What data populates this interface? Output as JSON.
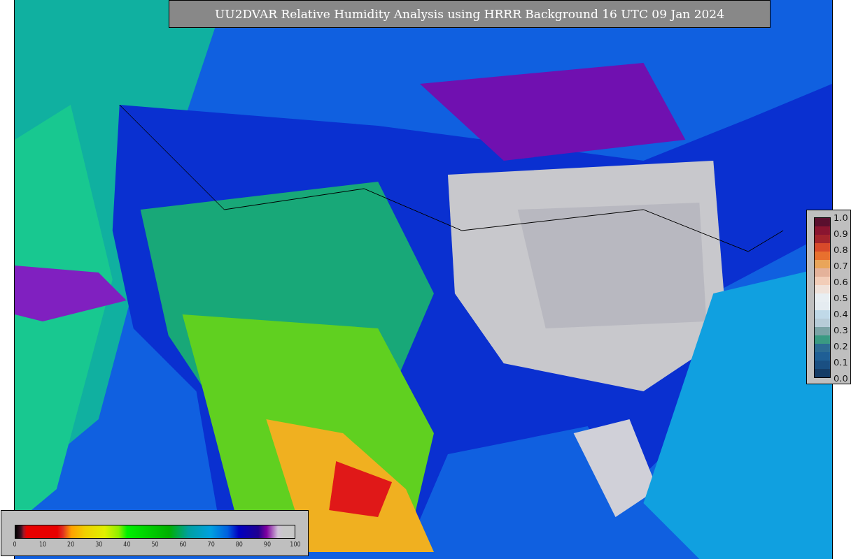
{
  "title": "UU2DVAR Relative Humidity Analysis using HRRR Background 16 UTC 09 Jan 2024",
  "humidity_scale": {
    "ticks": [
      "0",
      "10",
      "20",
      "30",
      "40",
      "50",
      "60",
      "70",
      "80",
      "90",
      "100"
    ]
  },
  "ratio_scale": {
    "ticks": [
      "1.0",
      "0.9",
      "0.8",
      "0.7",
      "0.6",
      "0.5",
      "0.4",
      "0.3",
      "0.2",
      "0.1",
      "0.0"
    ]
  }
}
